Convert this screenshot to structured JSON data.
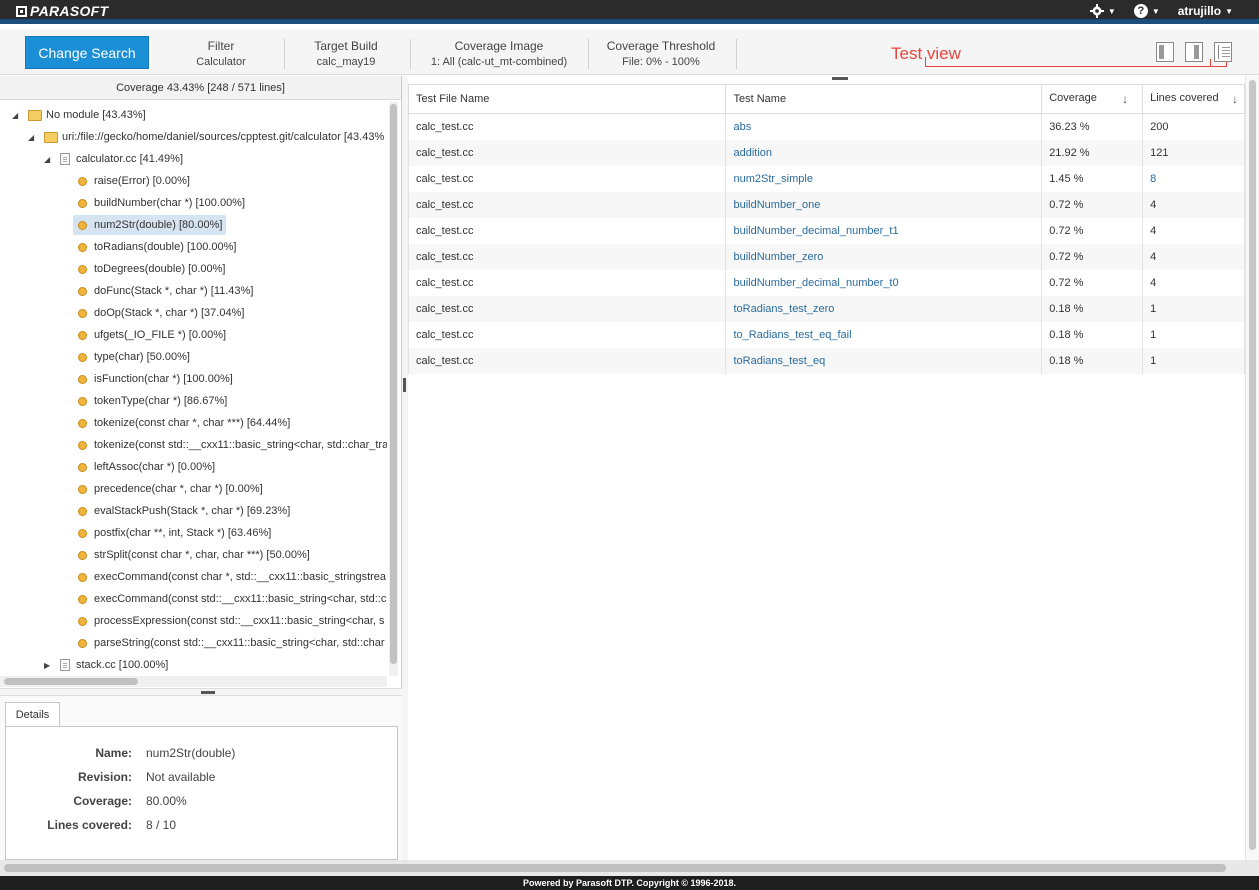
{
  "app": {
    "brand": "PARASOFT",
    "user": "atrujillo",
    "help_label": "?"
  },
  "search": {
    "change_label": "Change Search",
    "criteria": [
      {
        "label": "Filter",
        "value": "Calculator"
      },
      {
        "label": "Target Build",
        "value": "calc_may19"
      },
      {
        "label": "Coverage Image",
        "value": "1: All (calc-ut_mt-combined)"
      },
      {
        "label": "Coverage Threshold",
        "value": "File: 0% - 100%"
      }
    ],
    "annotation": "Test view"
  },
  "tree": {
    "coverage_header": "Coverage 43.43% [248 / 571 lines]",
    "module": "No module [43.43%]",
    "path": "uri:/file://gecko/home/daniel/sources/cpptest.git/calculator [43.43%",
    "file": "calculator.cc [41.49%]",
    "functions": [
      "raise(Error) [0.00%]",
      "buildNumber(char *) [100.00%]",
      "num2Str(double) [80.00%]",
      "toRadians(double) [100.00%]",
      "toDegrees(double) [0.00%]",
      "doFunc(Stack *, char *) [11.43%]",
      "doOp(Stack *, char *) [37.04%]",
      "ufgets(_IO_FILE *) [0.00%]",
      "type(char) [50.00%]",
      "isFunction(char *) [100.00%]",
      "tokenType(char *) [86.67%]",
      "tokenize(const char *, char ***) [64.44%]",
      "tokenize(const std::__cxx11::basic_string<char, std::char_tra",
      "leftAssoc(char *) [0.00%]",
      "precedence(char *, char *) [0.00%]",
      "evalStackPush(Stack *, char *) [69.23%]",
      "postfix(char **, int, Stack *) [63.46%]",
      "strSplit(const char *, char, char ***) [50.00%]",
      "execCommand(const char *, std::__cxx11::basic_stringstrea",
      "execCommand(const std::__cxx11::basic_string<char, std::c",
      "processExpression(const std::__cxx11::basic_string<char, s",
      "parseString(const std::__cxx11::basic_string<char, std::char"
    ],
    "file2": "stack.cc [100.00%]"
  },
  "details": {
    "tab": "Details",
    "rows": [
      {
        "k": "Name:",
        "v": "num2Str(double)"
      },
      {
        "k": "Revision:",
        "v": "Not available"
      },
      {
        "k": "Coverage:",
        "v": "80.00%"
      },
      {
        "k": "Lines covered:",
        "v": "8 / 10"
      }
    ]
  },
  "table": {
    "columns": [
      "Test File Name",
      "Test Name",
      "Coverage",
      "Lines covered"
    ],
    "sort_arrow": "↓",
    "rows": [
      [
        "calc_test.cc",
        "abs",
        "36.23 %",
        "200"
      ],
      [
        "calc_test.cc",
        "addition",
        "21.92 %",
        "121"
      ],
      [
        "calc_test.cc",
        "num2Str_simple",
        "1.45 %",
        "8"
      ],
      [
        "calc_test.cc",
        "buildNumber_one",
        "0.72 %",
        "4"
      ],
      [
        "calc_test.cc",
        "buildNumber_decimal_number_t1",
        "0.72 %",
        "4"
      ],
      [
        "calc_test.cc",
        "buildNumber_zero",
        "0.72 %",
        "4"
      ],
      [
        "calc_test.cc",
        "buildNumber_decimal_number_t0",
        "0.72 %",
        "4"
      ],
      [
        "calc_test.cc",
        "toRadians_test_zero",
        "0.18 %",
        "1"
      ],
      [
        "calc_test.cc",
        "to_Radians_test_eq_fail",
        "0.18 %",
        "1"
      ],
      [
        "calc_test.cc",
        "toRadians_test_eq",
        "0.18 %",
        "1"
      ]
    ]
  },
  "footer": "Powered by Parasoft DTP. Copyright © 1996-2018.",
  "colors": {
    "accent": "#1b8fd6",
    "annotation": "#e8453c",
    "topbar": "#2b2b2b"
  },
  "icons": [
    "gear-icon",
    "help-icon",
    "folder-icon",
    "file-icon",
    "function-dot-icon",
    "view-tree-icon",
    "view-split-icon",
    "view-test-icon"
  ]
}
